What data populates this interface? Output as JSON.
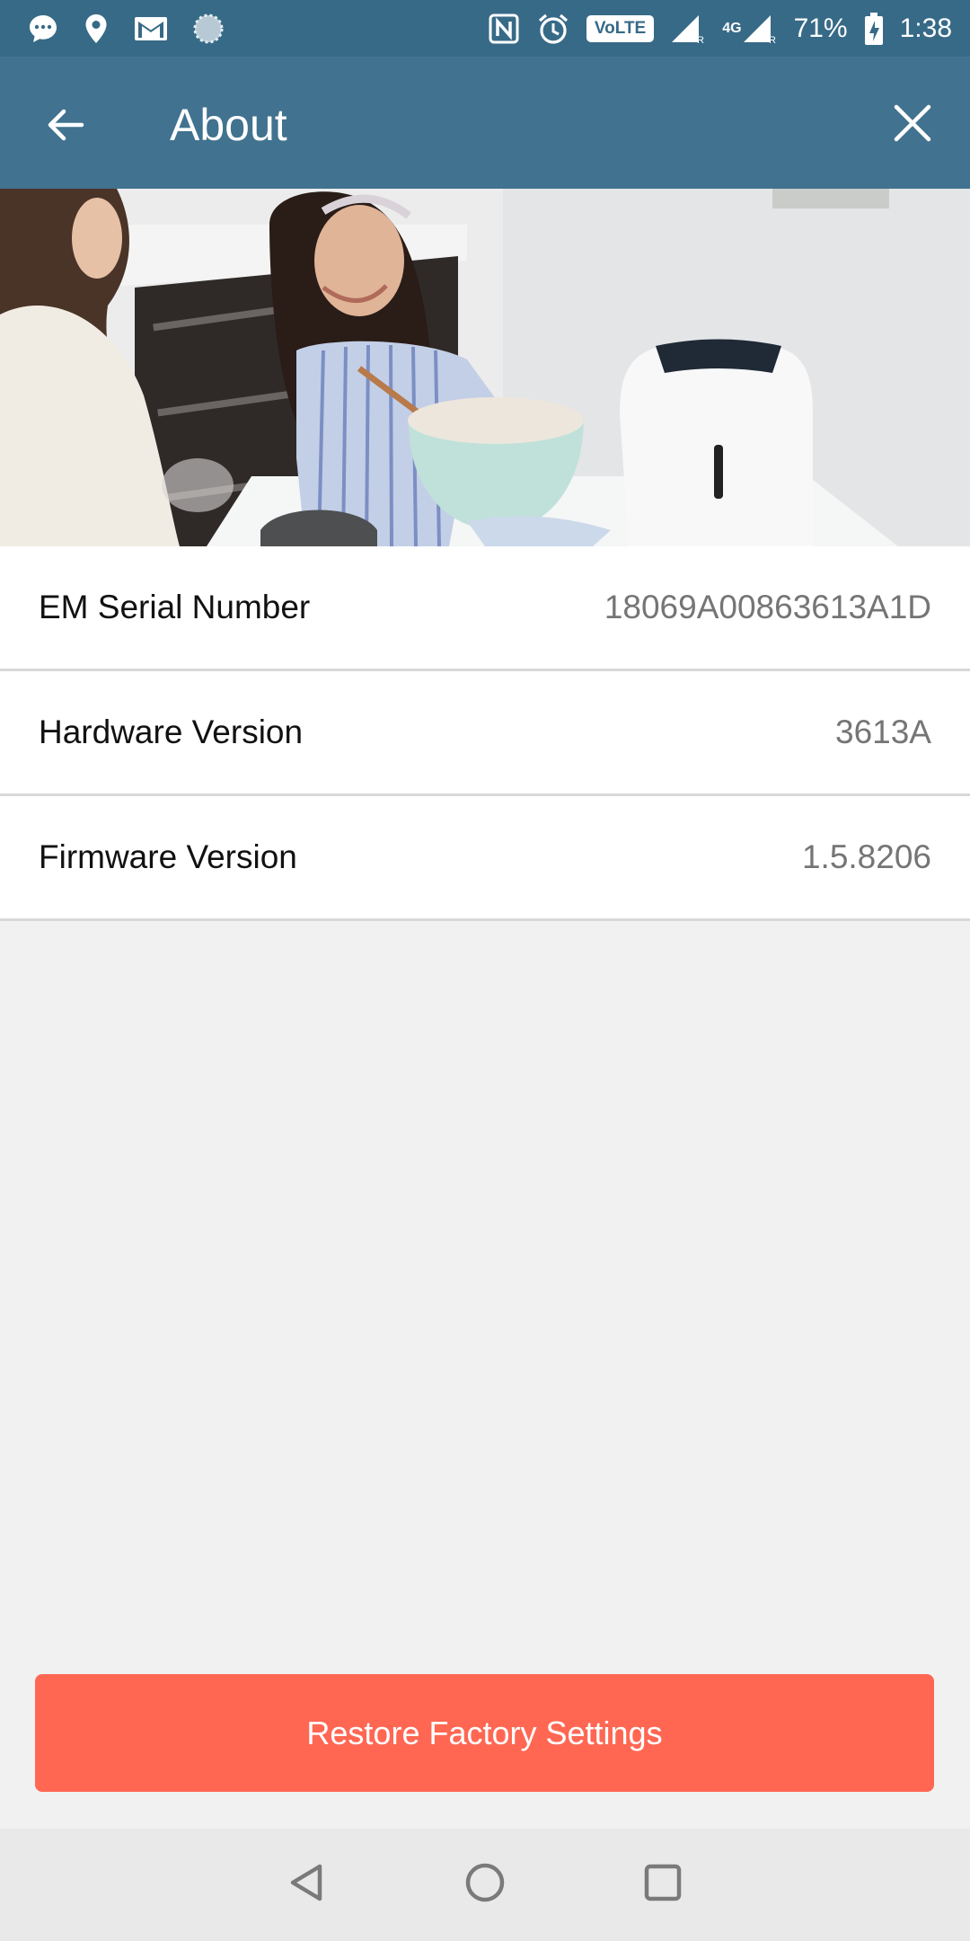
{
  "status_bar": {
    "battery": "71%",
    "time": "1:38",
    "volte_label": "VoLTE",
    "network_label": "4G",
    "icons": [
      "messaging-icon",
      "location-icon",
      "gmail-icon",
      "sync-icon",
      "nfc-icon",
      "alarm-icon",
      "volte-icon",
      "signal-icon",
      "signal-4g-icon",
      "battery-charging-icon"
    ]
  },
  "app_bar": {
    "title": "About",
    "back_icon": "arrow-left-icon",
    "close_icon": "close-icon"
  },
  "info": {
    "rows": [
      {
        "label": "EM Serial Number",
        "value": "18069A00863613A1D"
      },
      {
        "label": "Hardware Version",
        "value": "3613A"
      },
      {
        "label": "Firmware Version",
        "value": "1.5.8206"
      }
    ]
  },
  "actions": {
    "restore_label": "Restore Factory Settings"
  },
  "nav_bar": {
    "icons": [
      "back-triangle-icon",
      "home-circle-icon",
      "recents-square-icon"
    ]
  },
  "colors": {
    "status_bar": "#376a87",
    "app_bar": "#41728f",
    "accent_button": "#ff6753",
    "background": "#f1f1f1"
  }
}
